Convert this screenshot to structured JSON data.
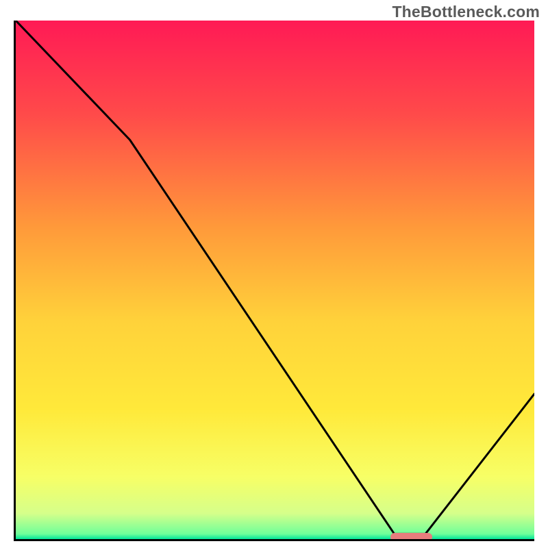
{
  "watermark": "TheBottleneck.com",
  "chart_data": {
    "type": "line",
    "title": "",
    "xlabel": "",
    "ylabel": "",
    "xlim": [
      0,
      100
    ],
    "ylim": [
      0,
      100
    ],
    "x": [
      0,
      22,
      73,
      79,
      100
    ],
    "values": [
      100,
      77,
      1,
      1,
      28
    ],
    "optimum_marker": {
      "x_start": 72,
      "x_end": 80,
      "y": 0.3
    },
    "gradient_stops": [
      {
        "offset": 0,
        "color": "#ff1a55"
      },
      {
        "offset": 18,
        "color": "#ff4a4a"
      },
      {
        "offset": 40,
        "color": "#ff9a3a"
      },
      {
        "offset": 58,
        "color": "#ffd23a"
      },
      {
        "offset": 75,
        "color": "#ffe93a"
      },
      {
        "offset": 88,
        "color": "#f7ff66"
      },
      {
        "offset": 95,
        "color": "#d6ff8a"
      },
      {
        "offset": 99,
        "color": "#6fff9a"
      },
      {
        "offset": 100,
        "color": "#00e49a"
      }
    ]
  }
}
